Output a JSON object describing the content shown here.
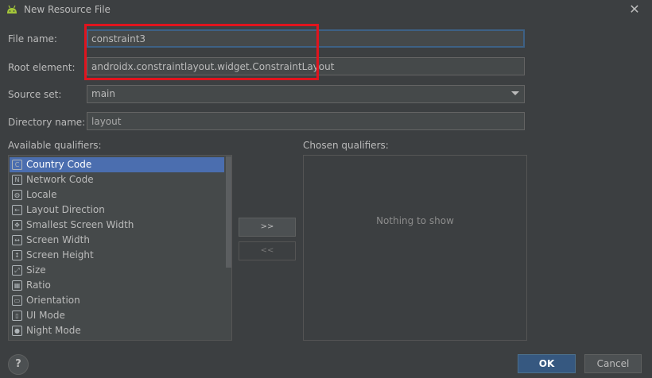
{
  "window": {
    "title": "New Resource File",
    "icon": "android-icon",
    "close_icon": "close-icon"
  },
  "form": {
    "file_name_label": "File name:",
    "file_name_value": "constraint3",
    "root_element_label": "Root element:",
    "root_element_value": "androidx.constraintlayout.widget.ConstraintLayout",
    "source_set_label": "Source set:",
    "source_set_value": "main",
    "directory_label": "Directory name:",
    "directory_value": "layout"
  },
  "qualifiers": {
    "available_label": "Available qualifiers:",
    "chosen_label": "Chosen qualifiers:",
    "empty_text": "Nothing to show",
    "add_label": ">>",
    "remove_label": "<<",
    "items": [
      {
        "label": "Country Code",
        "icon": "country-code-icon",
        "glyph": "C"
      },
      {
        "label": "Network Code",
        "icon": "network-code-icon",
        "glyph": "N"
      },
      {
        "label": "Locale",
        "icon": "globe-icon",
        "glyph": "◍"
      },
      {
        "label": "Layout Direction",
        "icon": "layout-direction-icon",
        "glyph": "←"
      },
      {
        "label": "Smallest Screen Width",
        "icon": "smallest-width-icon",
        "glyph": "✥"
      },
      {
        "label": "Screen Width",
        "icon": "screen-width-icon",
        "glyph": "↔"
      },
      {
        "label": "Screen Height",
        "icon": "screen-height-icon",
        "glyph": "↕"
      },
      {
        "label": "Size",
        "icon": "size-icon",
        "glyph": "⤢"
      },
      {
        "label": "Ratio",
        "icon": "ratio-icon",
        "glyph": "▦"
      },
      {
        "label": "Orientation",
        "icon": "orientation-icon",
        "glyph": "▭"
      },
      {
        "label": "UI Mode",
        "icon": "ui-mode-icon",
        "glyph": "▯"
      },
      {
        "label": "Night Mode",
        "icon": "night-mode-icon",
        "glyph": "●"
      }
    ],
    "selected_index": 0
  },
  "footer": {
    "help_label": "?",
    "ok_label": "OK",
    "cancel_label": "Cancel"
  },
  "colors": {
    "accent": "#4b6eaf",
    "highlight": "#e0141e",
    "background": "#3c3f41"
  }
}
